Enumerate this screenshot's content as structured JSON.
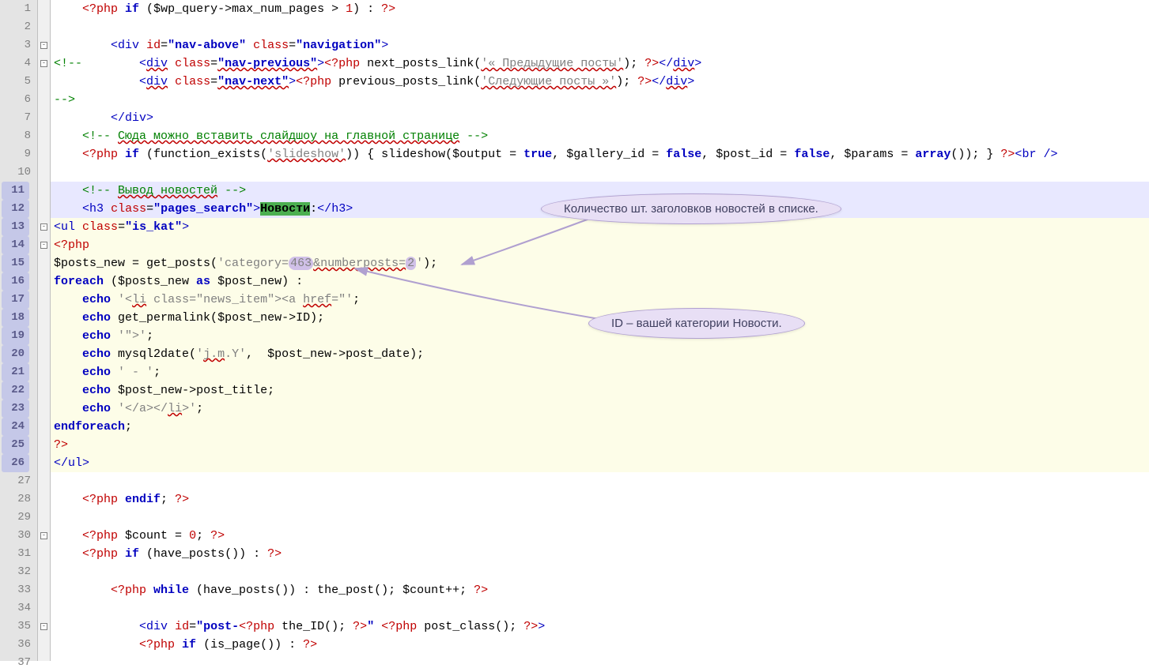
{
  "lines": [
    1,
    2,
    3,
    4,
    5,
    6,
    7,
    8,
    9,
    10,
    11,
    12,
    13,
    14,
    15,
    16,
    17,
    18,
    19,
    20,
    21,
    22,
    23,
    24,
    25,
    26,
    27,
    28,
    29,
    30,
    31,
    32,
    33,
    34,
    35,
    36,
    37
  ],
  "highlighted_gutter": [
    11,
    12,
    13,
    14,
    15,
    16,
    17,
    18,
    19,
    20,
    21,
    22,
    23,
    24,
    25,
    26
  ],
  "fold_markers": {
    "3": "-",
    "4": "-",
    "13": "-",
    "14": "-",
    "30": "-",
    "35": "-"
  },
  "callout1": "Количество шт. заголовков новостей в списке.",
  "callout2": "ID – вашей категории Новости.",
  "code": {
    "l1": {
      "open": "<?php ",
      "if": "if",
      "paren": " (",
      "var": "$wp_query",
      "arrow": "->",
      "prop": "max_num_pages",
      "op": " > ",
      "num": "1",
      "close": ") : ",
      "end": "?>"
    },
    "l3": {
      "open": "<",
      "tag": "div",
      "sp": " ",
      "a1": "id",
      "eq": "=",
      "v1": "\"nav-above\"",
      "sp2": " ",
      "a2": "class",
      "eq2": "=",
      "v2": "\"navigation\"",
      "close": ">"
    },
    "l4": {
      "cmt": "<!--        ",
      "open": "<",
      "tag": "div",
      "sp": " ",
      "a1": "class",
      "eq": "=",
      "v1": "\"nav-previous\"",
      "close": ">",
      "php": "<?php",
      "sp2": " ",
      "fn": "next_posts_link",
      "p": "(",
      "str": "'&laquo; Предыдущие посты'",
      "pc": "); ",
      "phpc": "?>",
      "ct": "</",
      "ctag": "div",
      "cc": ">"
    },
    "l5": {
      "sp": "            ",
      "open": "<",
      "tag": "div",
      "sp2": " ",
      "a1": "class",
      "eq": "=",
      "v1": "\"nav-next\"",
      "close": ">",
      "php": "<?php",
      "sp3": " ",
      "fn": "previous_posts_link",
      "p": "(",
      "str": "'Следующие посты &raquo;'",
      "pc": "); ",
      "phpc": "?>",
      "ct": "</",
      "ctag": "div",
      "cc": ">"
    },
    "l6": {
      "cmt": "-->"
    },
    "l7": {
      "ct": "</",
      "tag": "div",
      "cc": ">"
    },
    "l8": {
      "cmt": "<!-- Сюда можно вставить слайдшоу на главной странице -->"
    },
    "l9": {
      "php": "<?php ",
      "if": "if",
      "sp": " (",
      "fn": "function_exists",
      "p": "(",
      "str": "'slideshow'",
      "pc": ")) { ",
      "fn2": "slideshow",
      "p2": "(",
      "v1": "$output",
      "eq": " = ",
      "tf": "true",
      "c": ", ",
      "v2": "$gallery_id",
      "eq2": " = ",
      "tf2": "false",
      "c2": ", ",
      "v3": "$post_id",
      "eq3": " = ",
      "tf3": "false",
      "c3": ", ",
      "v4": "$params",
      "eq4": " = ",
      "arr": "array",
      "pc2": "()); } ",
      "phpc": "?>",
      "br": "<",
      "brtag": "br",
      "brc": " />"
    },
    "l11": {
      "cmt": "<!-- Вывод новостей -->"
    },
    "l12": {
      "open": "<",
      "tag": "h3",
      "sp": " ",
      "a1": "class",
      "eq": "=",
      "v1": "\"pages_search\"",
      "close": ">",
      "txt": "Новости",
      "colon": ":",
      "ct": "</",
      "ctag": "h3",
      "cc": ">"
    },
    "l13": {
      "open": "<",
      "tag": "ul",
      "sp": " ",
      "a1": "class",
      "eq": "=",
      "v1": "\"is_kat\"",
      "close": ">"
    },
    "l14": {
      "php": "<?php"
    },
    "l15": {
      "var": "$posts_new",
      "eq": " = ",
      "fn": "get_posts",
      "p": "(",
      "str1": "'category=",
      "num1": "463",
      "amp": "&numberposts=",
      "num2": "2",
      "str2": "'",
      "pc": ");"
    },
    "l16": {
      "fe": "foreach",
      "sp": " (",
      "v1": "$posts_new",
      "as": " as ",
      "v2": "$post_new",
      "pc": ") :"
    },
    "l17": {
      "echo": "echo",
      "sp": " ",
      "str": "'<li class=\"news_item\"><a href=\"'",
      "sc": ";"
    },
    "l18": {
      "echo": "echo",
      "sp": " ",
      "fn": "get_permalink",
      "p": "(",
      "v1": "$post_new",
      "arrow": "->",
      "prop": "ID",
      "pc": ");"
    },
    "l19": {
      "echo": "echo",
      "sp": " ",
      "str": "'\">'",
      "sc": ";"
    },
    "l20": {
      "echo": "echo",
      "sp": " ",
      "fn": "mysql2date",
      "p": "(",
      "str": "'j.m.Y'",
      "c": ",  ",
      "v1": "$post_new",
      "arrow": "->",
      "prop": "post_date",
      "pc": ");"
    },
    "l21": {
      "echo": "echo",
      "sp": " ",
      "str": "' - '",
      "sc": ";"
    },
    "l22": {
      "echo": "echo",
      "sp": " ",
      "v1": "$post_new",
      "arrow": "->",
      "prop": "post_title",
      "sc": ";"
    },
    "l23": {
      "echo": "echo",
      "sp": " ",
      "str": "'</a></li>'",
      "sc": ";"
    },
    "l24": {
      "ef": "endforeach",
      "sc": ";"
    },
    "l25": {
      "php": "?>"
    },
    "l26": {
      "ct": "</",
      "tag": "ul",
      "cc": ">"
    },
    "l28": {
      "php": "<?php ",
      "ei": "endif",
      "sc": "; ",
      "phpc": "?>"
    },
    "l30": {
      "php": "<?php ",
      "var": "$count",
      "eq": " = ",
      "num": "0",
      "sc": "; ",
      "phpc": "?>"
    },
    "l31": {
      "php": "<?php ",
      "if": "if",
      "sp": " (",
      "fn": "have_posts",
      "pc": "()) : ",
      "phpc": "?>"
    },
    "l33": {
      "php": "<?php ",
      "wh": "while",
      "sp": " (",
      "fn": "have_posts",
      "pc": "()) : ",
      "fn2": "the_post",
      "pc2": "(); ",
      "var": "$count",
      "inc": "++; ",
      "phpc": "?>"
    },
    "l35": {
      "open": "<",
      "tag": "div",
      "sp": " ",
      "a1": "id",
      "eq": "=",
      "q": "\"",
      "v1": "post-",
      "php": "<?php ",
      "fn": "the_ID",
      "pc": "(); ",
      "phpc": "?>",
      "q2": "\"",
      "sp2": " ",
      "php2": "<?php ",
      "fn2": "post_class",
      "pc2": "(); ",
      "phpc2": "?>",
      "close": ">"
    },
    "l36": {
      "php": "<?php ",
      "if": "if",
      "sp": " (",
      "fn": "is_page",
      "pc": "()) : ",
      "phpc": "?>"
    }
  }
}
